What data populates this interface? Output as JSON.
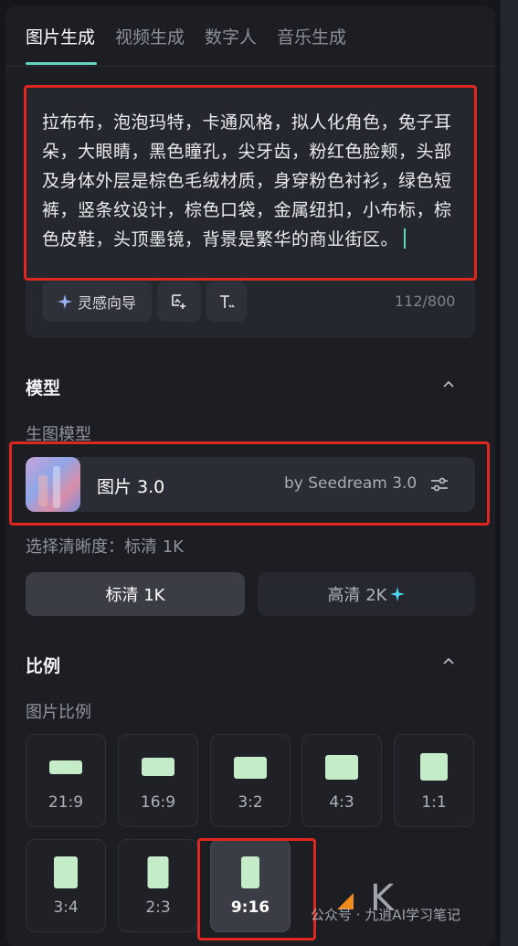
{
  "tabs": [
    {
      "label": "图片生成",
      "active": true
    },
    {
      "label": "视频生成",
      "active": false
    },
    {
      "label": "数字人",
      "active": false
    },
    {
      "label": "音乐生成",
      "active": false
    }
  ],
  "prompt": {
    "text": "拉布布，泡泡玛特，卡通风格，拟人化角色，兔子耳朵，大眼睛，黑色瞳孔，尖牙齿，粉红色脸颊，头部及身体外层是棕色毛绒材质，身穿粉色衬衫，绿色短裤，竖条纹设计，棕色口袋，金属纽扣，小布标，棕色皮鞋，头顶墨镜，背景是繁华的商业街区。",
    "inspiration_button": "灵感向导",
    "counter": "112/800"
  },
  "model_section": {
    "title": "模型",
    "sub_label": "生图模型",
    "model_name": "图片 3.0",
    "model_by": "by Seedream 3.0"
  },
  "resolution": {
    "label": "选择清晰度：标清 1K",
    "options": [
      {
        "label": "标清 1K",
        "selected": true
      },
      {
        "label": "高清 2K",
        "selected": false
      }
    ]
  },
  "ratio_section": {
    "title": "比例",
    "sub_label": "图片比例",
    "options": [
      {
        "label": "21:9",
        "selected": false
      },
      {
        "label": "16:9",
        "selected": false
      },
      {
        "label": "3:2",
        "selected": false
      },
      {
        "label": "4:3",
        "selected": false
      },
      {
        "label": "1:1",
        "selected": false
      },
      {
        "label": "3:4",
        "selected": false
      },
      {
        "label": "2:3",
        "selected": false
      },
      {
        "label": "9:16",
        "selected": true
      }
    ]
  },
  "watermark": {
    "text": "公众号 · 九逍AI学习笔记"
  },
  "colors": {
    "accent": "#61d7c3",
    "highlight_box": "#e0271f",
    "ratio_shape": "#c4ecc9",
    "sparkle": "#4fd6f0"
  }
}
